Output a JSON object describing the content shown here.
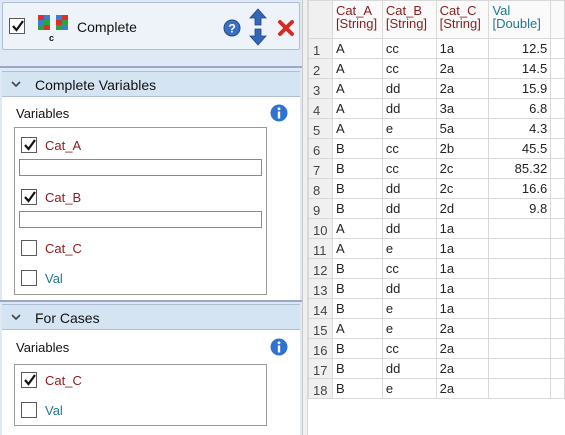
{
  "header": {
    "title": "Complete",
    "checked": true
  },
  "complete_section": {
    "title": "Complete Variables",
    "variables_label": "Variables",
    "variables": [
      {
        "name": "Cat_A",
        "type": "string",
        "checked": true,
        "has_field": true
      },
      {
        "name": "Cat_B",
        "type": "string",
        "checked": true,
        "has_field": true
      },
      {
        "name": "Cat_C",
        "type": "string",
        "checked": false,
        "has_field": false
      },
      {
        "name": "Val",
        "type": "double",
        "checked": false,
        "has_field": false
      }
    ]
  },
  "for_cases_section": {
    "title": "For Cases",
    "variables_label": "Variables",
    "variables": [
      {
        "name": "Cat_C",
        "type": "string",
        "checked": true
      },
      {
        "name": "Val",
        "type": "double",
        "checked": false
      }
    ]
  },
  "grid": {
    "columns": [
      {
        "name": "Cat_A",
        "type": "[String]"
      },
      {
        "name": "Cat_B",
        "type": "[String]"
      },
      {
        "name": "Cat_C",
        "type": "[String]"
      },
      {
        "name": "Val",
        "type": "[Double]"
      }
    ],
    "rows": [
      {
        "n": "1",
        "a": "A",
        "b": "cc",
        "c": "1a",
        "v": "12.5"
      },
      {
        "n": "2",
        "a": "A",
        "b": "cc",
        "c": "2a",
        "v": "14.5"
      },
      {
        "n": "3",
        "a": "A",
        "b": "dd",
        "c": "2a",
        "v": "15.9"
      },
      {
        "n": "4",
        "a": "A",
        "b": "dd",
        "c": "3a",
        "v": "6.8"
      },
      {
        "n": "5",
        "a": "A",
        "b": "e",
        "c": "5a",
        "v": "4.3"
      },
      {
        "n": "6",
        "a": "B",
        "b": "cc",
        "c": "2b",
        "v": "45.5"
      },
      {
        "n": "7",
        "a": "B",
        "b": "cc",
        "c": "2c",
        "v": "85.32"
      },
      {
        "n": "8",
        "a": "B",
        "b": "dd",
        "c": "2c",
        "v": "16.6"
      },
      {
        "n": "9",
        "a": "B",
        "b": "dd",
        "c": "2d",
        "v": "9.8"
      },
      {
        "n": "10",
        "a": "A",
        "b": "dd",
        "c": "1a",
        "v": ""
      },
      {
        "n": "11",
        "a": "A",
        "b": "e",
        "c": "1a",
        "v": ""
      },
      {
        "n": "12",
        "a": "B",
        "b": "cc",
        "c": "1a",
        "v": ""
      },
      {
        "n": "13",
        "a": "B",
        "b": "dd",
        "c": "1a",
        "v": ""
      },
      {
        "n": "14",
        "a": "B",
        "b": "e",
        "c": "1a",
        "v": ""
      },
      {
        "n": "15",
        "a": "A",
        "b": "e",
        "c": "2a",
        "v": ""
      },
      {
        "n": "16",
        "a": "B",
        "b": "cc",
        "c": "2a",
        "v": ""
      },
      {
        "n": "17",
        "a": "B",
        "b": "dd",
        "c": "2a",
        "v": ""
      },
      {
        "n": "18",
        "a": "B",
        "b": "e",
        "c": "2a",
        "v": ""
      }
    ]
  },
  "colors": {
    "string_var": "#8b1c1c",
    "double_var": "#1c7a8a",
    "panel_bg": "#dfe9f5",
    "section_bar": "#d5e4f3"
  },
  "icons": {
    "header": "complete-cases-icon",
    "help": "help-icon",
    "move_up": "arrow-up-icon",
    "move_down": "arrow-down-icon",
    "delete": "delete-x-icon",
    "info": "info-icon",
    "collapse": "chevron-down-icon"
  }
}
